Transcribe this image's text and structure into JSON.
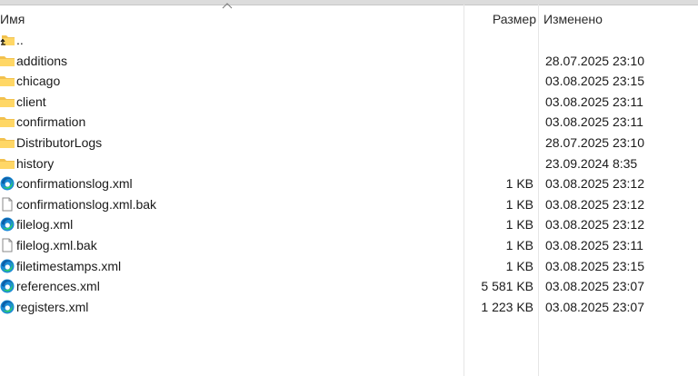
{
  "header": {
    "name_label": "Имя",
    "size_label": "Размер",
    "modified_label": "Изменено"
  },
  "items": [
    {
      "name": "..",
      "size": "",
      "modified": "",
      "icon": "up-folder-icon"
    },
    {
      "name": "additions",
      "size": "",
      "modified": "28.07.2025 23:10",
      "icon": "folder-icon"
    },
    {
      "name": "chicago",
      "size": "",
      "modified": "03.08.2025 23:15",
      "icon": "folder-icon"
    },
    {
      "name": "client",
      "size": "",
      "modified": "03.08.2025 23:11",
      "icon": "folder-icon"
    },
    {
      "name": "confirmation",
      "size": "",
      "modified": "03.08.2025 23:11",
      "icon": "folder-icon"
    },
    {
      "name": "DistributorLogs",
      "size": "",
      "modified": "28.07.2025 23:10",
      "icon": "folder-icon"
    },
    {
      "name": "history",
      "size": "",
      "modified": "23.09.2024 8:35",
      "icon": "folder-icon"
    },
    {
      "name": "confirmationslog.xml",
      "size": "1 KB",
      "modified": "03.08.2025 23:12",
      "icon": "edge-xml-icon"
    },
    {
      "name": "confirmationslog.xml.bak",
      "size": "1 KB",
      "modified": "03.08.2025 23:12",
      "icon": "file-icon"
    },
    {
      "name": "filelog.xml",
      "size": "1 KB",
      "modified": "03.08.2025 23:12",
      "icon": "edge-xml-icon"
    },
    {
      "name": "filelog.xml.bak",
      "size": "1 KB",
      "modified": "03.08.2025 23:11",
      "icon": "file-icon"
    },
    {
      "name": "filetimestamps.xml",
      "size": "1 KB",
      "modified": "03.08.2025 23:15",
      "icon": "edge-xml-icon"
    },
    {
      "name": "references.xml",
      "size": "5 581 KB",
      "modified": "03.08.2025 23:07",
      "icon": "edge-xml-icon"
    },
    {
      "name": "registers.xml",
      "size": "1 223 KB",
      "modified": "03.08.2025 23:07",
      "icon": "edge-xml-icon"
    }
  ]
}
